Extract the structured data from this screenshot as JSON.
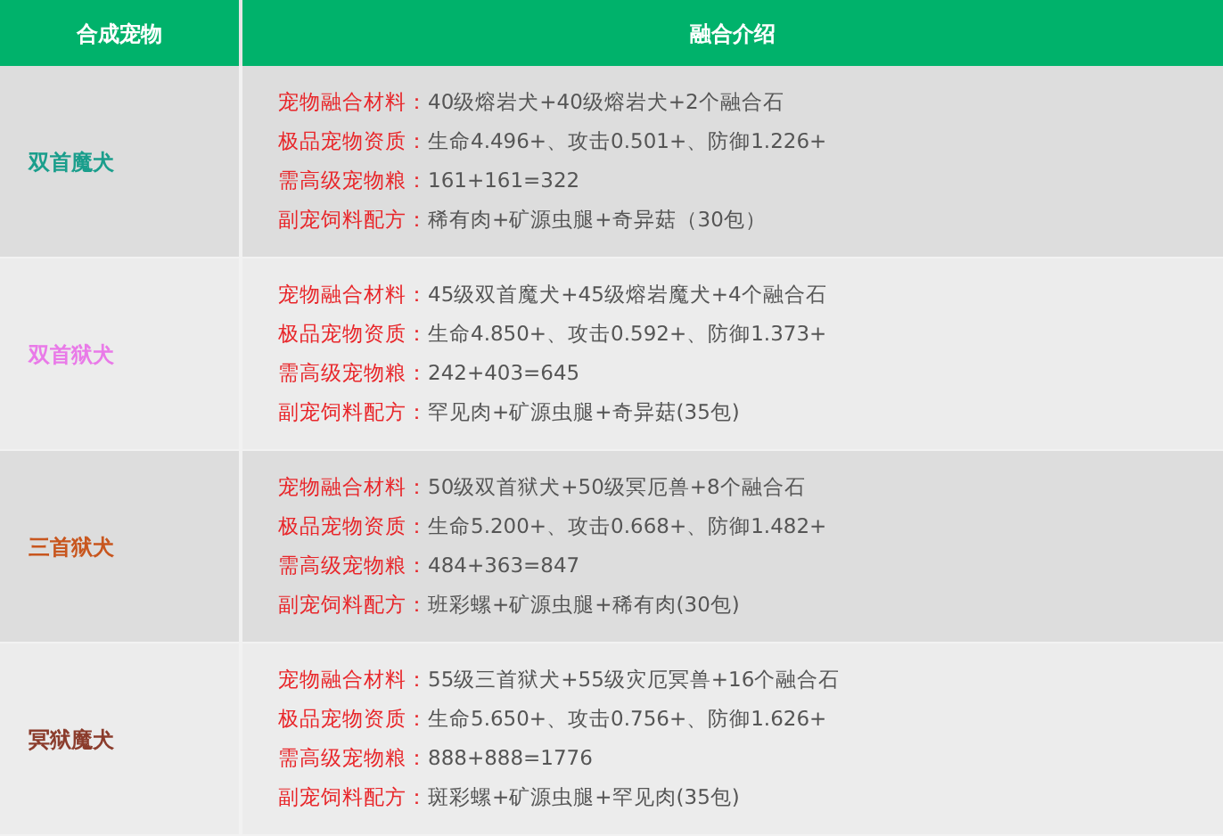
{
  "table": {
    "columns": [
      "合成宠物",
      "融合介绍"
    ],
    "rows": [
      {
        "name": "双首魔犬",
        "color": "#1a9e8c",
        "details": [
          {
            "label": "宠物融合材料：",
            "value": "40级熔岩犬+40级熔岩犬+2个融合石"
          },
          {
            "label": "极品宠物资质：",
            "value": "生命4.496+、攻击0.501+、防御1.226+"
          },
          {
            "label": "需高级宠物粮：",
            "value": "161+161=322"
          },
          {
            "label": "副宠饲料配方：",
            "value": "稀有肉+矿源虫腿+奇异菇（30包）"
          }
        ]
      },
      {
        "name": "双首狱犬",
        "color": "#e97ae8",
        "details": [
          {
            "label": "宠物融合材料：",
            "value": "45级双首魔犬+45级熔岩魔犬+4个融合石"
          },
          {
            "label": "极品宠物资质：",
            "value": "生命4.850+、攻击0.592+、防御1.373+"
          },
          {
            "label": "需高级宠物粮：",
            "value": "242+403=645"
          },
          {
            "label": "副宠饲料配方：",
            "value": "罕见肉+矿源虫腿+奇异菇(35包)"
          }
        ]
      },
      {
        "name": "三首狱犬",
        "color": "#c8561e",
        "details": [
          {
            "label": "宠物融合材料：",
            "value": "50级双首狱犬+50级冥厄兽+8个融合石"
          },
          {
            "label": "极品宠物资质：",
            "value": "生命5.200+、攻击0.668+、防御1.482+"
          },
          {
            "label": "需高级宠物粮：",
            "value": "484+363=847"
          },
          {
            "label": "副宠饲料配方：",
            "value": "班彩螺+矿源虫腿+稀有肉(30包)"
          }
        ]
      },
      {
        "name": "冥狱魔犬",
        "color": "#8b3c2c",
        "details": [
          {
            "label": "宠物融合材料：",
            "value": "55级三首狱犬+55级灾厄冥兽+16个融合石"
          },
          {
            "label": "极品宠物资质：",
            "value": "生命5.650+、攻击0.756+、防御1.626+"
          },
          {
            "label": "需高级宠物粮：",
            "value": "888+888=1776"
          },
          {
            "label": "副宠饲料配方：",
            "value": "斑彩螺+矿源虫腿+罕见肉(35包)"
          }
        ]
      }
    ]
  }
}
